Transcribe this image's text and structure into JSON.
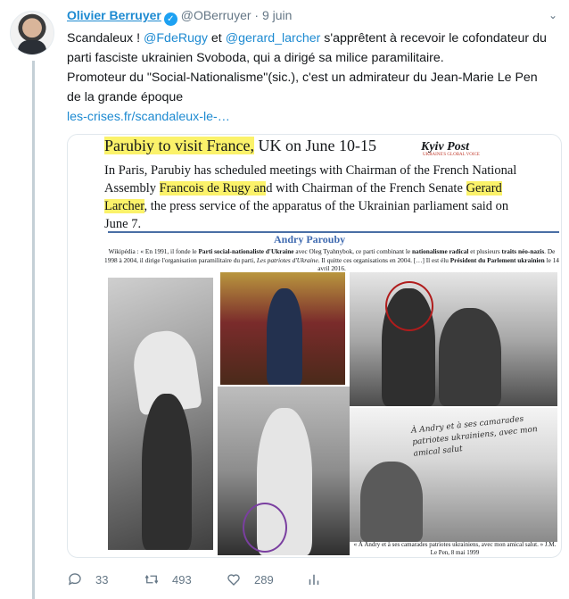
{
  "author": {
    "name": "Olivier Berruyer",
    "handle": "@OBerruyer",
    "separator": "·",
    "date": "9 juin"
  },
  "tweet": {
    "line1_a": "Scandaleux ! ",
    "mention1": "@FdeRugy",
    "line1_b": " et ",
    "mention2": "@gerard_larcher",
    "line1_c": " s'apprêtent à recevoir le cofondateur du parti fasciste ukrainien Svoboda, qui a dirigé sa milice paramilitaire.",
    "line2": "Promoteur du \"Social-Nationalisme\"(sic.), c'est un admirateur du Jean-Marie Le Pen de la grande époque",
    "link": "les-crises.fr/scandaleux-le-…"
  },
  "media": {
    "headline_hl": "Parubiy to visit France,",
    "headline_rest": " UK on June 10-15",
    "logo": "Kyiv Post",
    "logo_sub": "UKRAINE'S GLOBAL VOICE",
    "p_a": "In Paris, Parubiy has scheduled meetings with Chairman of the French National Assembly ",
    "p_hl1": "Francois de Rugy an",
    "p_b": "d with Chairman of the French Senate ",
    "p_hl2": "Gerard Larcher",
    "p_c": ", the press service of the apparatus of the Ukrainian parliament said on June 7.",
    "section_title": "Andry Parouby",
    "wiki_1": "Wikipédia : « En 1991, il fonde le ",
    "wiki_b1": "Parti social-nationaliste d'Ukraine",
    "wiki_2": " avec Oleg Tyahnybok, ce parti combinant le ",
    "wiki_b2": "nationalisme radical",
    "wiki_3": " et plusieurs ",
    "wiki_b3": "traits néo-nazis",
    "wiki_4": ". De 1998 à 2004, il dirige l'organisation paramilitaire du parti, ",
    "wiki_i": "Les patriotes d'Ukraine",
    "wiki_5": ". Il quitte ces organisations en 2004. […] Il est élu ",
    "wiki_b4": "Président du Parlement ukrainien",
    "wiki_6": " le 14 avril 2016.",
    "handwriting": "À Andry et à ses camarades patriotes ukrainiens, avec mon amical salut",
    "caption": "« À Andry et à ses camarades patriotes ukrainiens, avec mon amical salut. » J.M. Le Pen, 8 mai 1999"
  },
  "actions": {
    "replies": "33",
    "retweets": "493",
    "likes": "289"
  },
  "colors": {
    "link": "#1d8ad1",
    "highlight": "#fbf26a",
    "muted": "#657786"
  }
}
